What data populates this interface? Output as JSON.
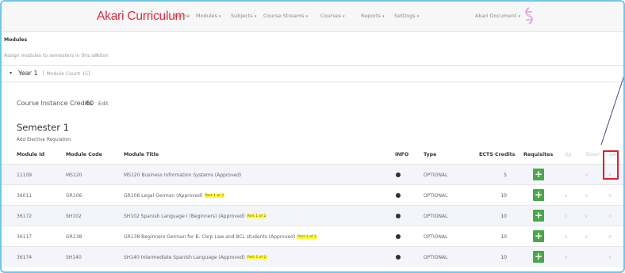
{
  "brand": "Akari Curriculum",
  "nav": {
    "items": [
      {
        "label": "Home",
        "caret": false
      },
      {
        "label": "Modules",
        "caret": true
      },
      {
        "label": "Subjects",
        "caret": true
      },
      {
        "label": "Course Streams",
        "caret": true
      },
      {
        "label": "Courses",
        "caret": true
      },
      {
        "label": "Reports",
        "caret": true
      },
      {
        "label": "Settings",
        "caret": true
      }
    ],
    "user_menu": "Akari Document",
    "caret_glyph": "▾"
  },
  "page": {
    "heading": "Modules",
    "subtitle": "Assign modules to semesters in this section",
    "year_label": "Year 1",
    "module_count": "[ Module Count 15]",
    "credits_label": "Course Instance Credits",
    "credits_value": "60",
    "credits_edit": "Edit",
    "semester_title": "Semester 1",
    "add_elective": "Add Elective Regulation"
  },
  "table": {
    "headers": {
      "module_id": "Module Id",
      "module_code": "Module Code",
      "module_title": "Module Title",
      "info": "INFO",
      "type": "Type",
      "ects": "ECTS Credits",
      "requisites": "Requisites",
      "up": "Up",
      "down": "Down",
      "del": "Del"
    },
    "rows": [
      {
        "id": "11109",
        "code": "MS120",
        "title": "MS120 Business Information Systems (Approved)",
        "badge": "",
        "type": "OPTIONAL",
        "ects": "5",
        "up": false,
        "down": true
      },
      {
        "id": "36011",
        "code": "GR106",
        "title": "GR106 Legal German (Approved)",
        "badge": "Part 1 of 2",
        "type": "OPTIONAL",
        "ects": "10",
        "up": true,
        "down": true
      },
      {
        "id": "36172",
        "code": "SH102",
        "title": "SH102 Spanish Language I (Beginners) (Approved)",
        "badge": "Part 1 of 2",
        "type": "OPTIONAL",
        "ects": "10",
        "up": true,
        "down": true
      },
      {
        "id": "36117",
        "code": "GR138",
        "title": "GR138 Beginners German for B. Corp Law and BCL students (Approved)",
        "badge": "Part 1 of 2",
        "type": "OPTIONAL",
        "ects": "10",
        "up": true,
        "down": true
      },
      {
        "id": "36174",
        "code": "SH140",
        "title": "SH140 Intermediate Spanish Language (Approved)",
        "badge": "Part 1 of 2",
        "type": "OPTIONAL",
        "ects": "10",
        "up": true,
        "down": false
      }
    ]
  },
  "glyphs": {
    "plus": "+",
    "up": "∧",
    "down": "∨",
    "del": "x",
    "pencil": "✎",
    "year_caret": "▾"
  },
  "colors": {
    "brand": "#e0283c",
    "accent_green": "#4aa64a",
    "highlight_box": "#e01e2d",
    "badge_yellow": "#fffb3a",
    "frame": "#6fc6e8"
  }
}
